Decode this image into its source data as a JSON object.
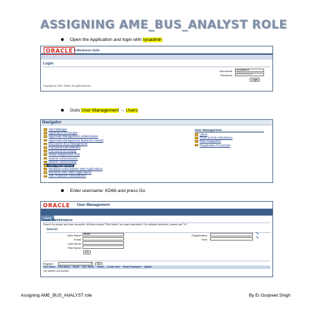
{
  "doc": {
    "title": "ASSIGNING AME_BUS_ANALYST ROLE",
    "steps": [
      {
        "text_before": "Open the Application and login with ",
        "highlight": "sysadmin"
      },
      {
        "text_before": "Goto ",
        "highlight1": "User Management",
        "arrow": "→",
        "highlight2": "Users"
      },
      {
        "text_before": "Enter username: KD66 and press Go"
      }
    ],
    "footer_left": "Assigning AME_BUS_ANALYST role",
    "footer_right": "By Er Gurpreet Singh"
  },
  "login_screen": {
    "logo": "ORACLE",
    "suite": "E-Business Suite",
    "heading": "Login",
    "username_label": "Username",
    "username_value": "sysadmin",
    "password_label": "Password",
    "password_value": "••••••••••",
    "login_button": "Login",
    "copyright": "Copyright (c) 2006, Oracle. All rights reserved."
  },
  "navigator_screen": {
    "heading": "Navigator",
    "responsibilities": [
      "Alert Manager",
      "Application Developer",
      "Approvals Management Administrator",
      "Approvals Management Business Analyst",
      "Discoverer EUL Management",
      "Functional Administrator",
      "Functional Developer",
      "Oracle Diagnostics Tool",
      "System Administration",
      "System Administrator",
      "User Management",
      "Workflow Administrator Web Applications",
      "Workflow User Web Applications",
      "XML Publisher Administrator"
    ],
    "selected_index": 10,
    "menu_heading": "User Management",
    "menu_items": [
      "Users",
      "Roles & Role Inheritance",
      "Role Categories",
      "Registration Processes"
    ]
  },
  "user_maint_screen": {
    "logo": "ORACLE",
    "app": "User Management",
    "tabs": [
      "Users",
      "Roles & Role Inheritance",
      "Role Categories",
      "Registration Processes"
    ],
    "active_tab": 0,
    "heading": "User Maintenance",
    "note": "Search for people and user accounts. All fields except \"First Name\" are case insensitive. For wildcard searches, please use \"%\"",
    "search_heading": "Search",
    "fields": {
      "user_name_label": "User Name",
      "user_name_value": "KD66",
      "email_label": "Email",
      "last_name_label": "Last Name",
      "first_name_label": "First Name",
      "organization_label": "Organization",
      "role_label": "Role"
    },
    "go_button": "Go",
    "register_label": "Register",
    "register_go": "Go",
    "columns": [
      "User Name",
      "First Name",
      "Email",
      "User Name",
      "Status",
      "Create User",
      "Reset Password",
      "Update"
    ],
    "empty_text": "No search conducted."
  }
}
